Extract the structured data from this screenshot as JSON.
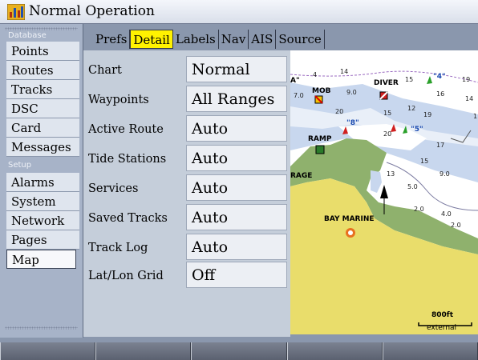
{
  "window": {
    "title": "Normal Operation",
    "icon": "bar-chart-icon"
  },
  "sidebar": {
    "section_database": "Database",
    "section_setup": "Setup",
    "items": [
      {
        "label": "Points",
        "selected": false
      },
      {
        "label": "Routes",
        "selected": false
      },
      {
        "label": "Tracks",
        "selected": false
      },
      {
        "label": "DSC",
        "selected": false
      },
      {
        "label": "Card",
        "selected": false
      },
      {
        "label": "Messages",
        "selected": false
      },
      {
        "label": "Alarms",
        "selected": false
      },
      {
        "label": "System",
        "selected": false
      },
      {
        "label": "Network",
        "selected": false
      },
      {
        "label": "Pages",
        "selected": false
      },
      {
        "label": "Map",
        "selected": true
      }
    ]
  },
  "tabs": [
    {
      "label": "Prefs",
      "active": false
    },
    {
      "label": "Detail",
      "active": true
    },
    {
      "label": "Labels",
      "active": false
    },
    {
      "label": "Nav",
      "active": false
    },
    {
      "label": "AIS",
      "active": false
    },
    {
      "label": "Source",
      "active": false
    }
  ],
  "settings": [
    {
      "label": "Chart",
      "value": "Normal"
    },
    {
      "label": "Waypoints",
      "value": "All Ranges"
    },
    {
      "label": "Active Route",
      "value": "Auto"
    },
    {
      "label": "Tide Stations",
      "value": "Auto"
    },
    {
      "label": "Services",
      "value": "Auto"
    },
    {
      "label": "Saved Tracks",
      "value": "Auto"
    },
    {
      "label": "Track Log",
      "value": "Auto"
    },
    {
      "label": "Lat/Lon Grid",
      "value": "Off"
    }
  ],
  "map": {
    "labels": {
      "mob": "MOB",
      "diver": "DIVER",
      "ramp": "RAMP",
      "bay_marine": "BAY MARINE",
      "rage": "RAGE",
      "a": "A\"",
      "buoy4": "\"4\"",
      "buoy8": "\"8\"",
      "buoy5": "\"5\""
    },
    "depths": [
      "14",
      "4",
      "15",
      "19",
      "7.0",
      "9.0",
      "16",
      "14",
      "20",
      "12",
      "15",
      "19",
      "20",
      "17",
      "15",
      "9.0",
      "13",
      "5.0",
      "2.0",
      "4.0",
      "2.0",
      "1"
    ],
    "scale": "800ft",
    "source": "external",
    "colors": {
      "water_deep": "#ffffff",
      "water_shallow": "#c8d7ee",
      "land": "#e9dd6b",
      "marsh": "#8fb16d"
    }
  },
  "softkeys": [
    "",
    "",
    "",
    "",
    ""
  ]
}
